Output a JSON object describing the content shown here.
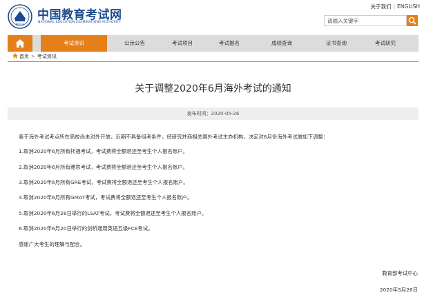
{
  "header": {
    "logo_cn": "中国教育考试网",
    "logo_en": "NATIONAL EDUCATION EXAMINATIONS AUTHORITY",
    "links": [
      "关于我们",
      "ENGLISH"
    ],
    "search": {
      "placeholder": "请输入关键字"
    }
  },
  "colors": {
    "accent": "#e47f1a",
    "brand": "#1e4b8f",
    "nav_bg": "#dcdcdc",
    "date_bar_bg": "#eeeeee"
  },
  "nav": {
    "home_icon": "home-icon",
    "items": [
      {
        "label": "考试资讯",
        "active": true
      },
      {
        "label": "公示公告"
      },
      {
        "label": "考试项目"
      },
      {
        "label": "考试报名"
      },
      {
        "label": "成绩查询"
      },
      {
        "label": "证书查询"
      },
      {
        "label": "考试研究"
      }
    ]
  },
  "breadcrumb": {
    "home": "首页",
    "current": "考试资讯"
  },
  "article": {
    "title": "关于调整2020年6月海外考试的通知",
    "publish_time": "发布时间：2020-05-26",
    "paragraphs": [
      "鉴于海外考试考点所在高校尚未对外开放，近期不具备组考条件，经研究并商相关国外考试主办机构，决定对6月份海外考试做如下调整：",
      "1.取消2020年6月所有托福考试，考试费将全额退还至考生个人报名账户。",
      "2.取消2020年6月所有雅思考试，考试费将全额退还至考生个人报名账户。",
      "3.取消2020年6月所有GRE考试，考试费将全额退还至考生个人报名账户。",
      "4.取消2020年6月所有GMAT考试，考试费将全额退还至考生个人报名账户。",
      "5.取消2020年6月28日举行的LSAT考试，考试费将全额退还至考生个人报名账户。",
      "6.取消2020年6月20日举行的剑桥通用英语五级FCE考试。",
      "感谢广大考生的理解与配合。"
    ],
    "signature": "教育部考试中心",
    "sign_date": "2020年5月26日"
  }
}
